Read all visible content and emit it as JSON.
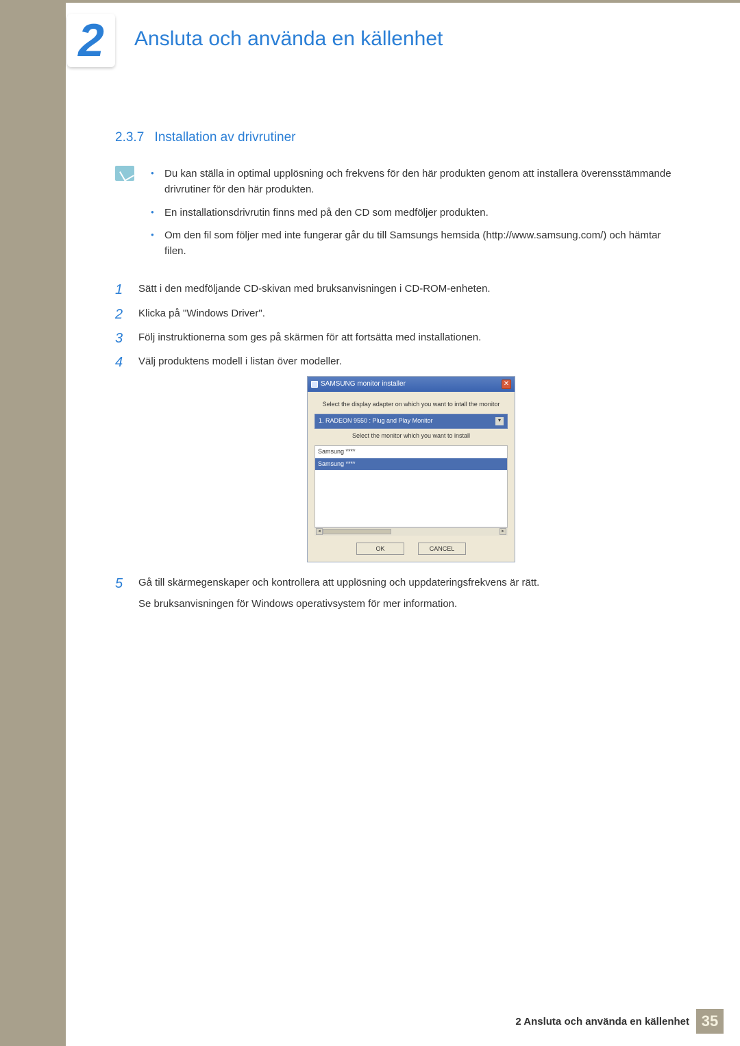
{
  "chapter": {
    "number": "2",
    "title": "Ansluta och använda en källenhet"
  },
  "section": {
    "number": "2.3.7",
    "title": "Installation av drivrutiner"
  },
  "notes": [
    "Du kan ställa in optimal upplösning och frekvens för den här produkten genom att installera överensstämmande drivrutiner för den här produkten.",
    "En installationsdrivrutin finns med på den CD som medföljer produkten.",
    "Om den fil som följer med inte fungerar går du till Samsungs hemsida (http://www.samsung.com/) och hämtar filen."
  ],
  "steps": [
    {
      "n": "1",
      "text": "Sätt i den medföljande CD-skivan med bruksanvisningen i CD-ROM-enheten."
    },
    {
      "n": "2",
      "text": "Klicka på \"Windows Driver\"."
    },
    {
      "n": "3",
      "text": "Följ instruktionerna som ges på skärmen för att fortsätta med installationen."
    },
    {
      "n": "4",
      "text": "Välj produktens modell i listan över modeller."
    },
    {
      "n": "5",
      "text": "Gå till skärmegenskaper och kontrollera att upplösning och uppdateringsfrekvens är rätt.",
      "extra": "Se bruksanvisningen för Windows operativsystem för mer information."
    }
  ],
  "installer": {
    "title": "SAMSUNG monitor installer",
    "label1": "Select the display adapter on which you want to intall the monitor",
    "dropdown": "1. RADEON 9550 : Plug and Play Monitor",
    "label2": "Select the monitor which you want to install",
    "list": [
      "Samsung ****",
      "Samsung ****"
    ],
    "ok": "OK",
    "cancel": "CANCEL"
  },
  "footer": {
    "text": "2 Ansluta och använda en källenhet",
    "page": "35"
  }
}
